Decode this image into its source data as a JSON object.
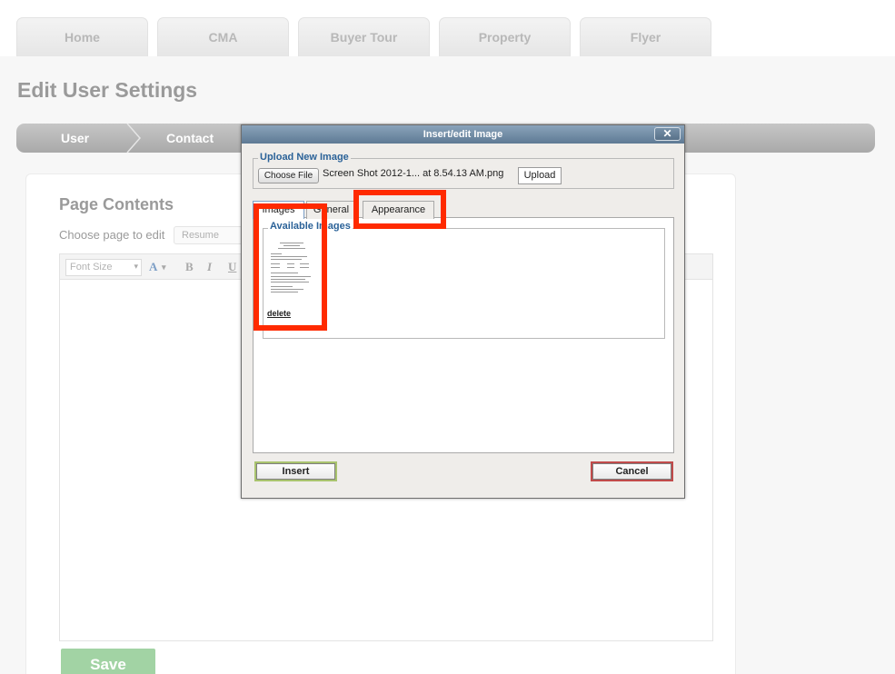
{
  "nav": {
    "tabs": [
      {
        "label": "Home"
      },
      {
        "label": "CMA"
      },
      {
        "label": "Buyer Tour"
      },
      {
        "label": "Property"
      },
      {
        "label": "Flyer"
      }
    ]
  },
  "page": {
    "title": "Edit User Settings",
    "breadcrumb": [
      "User",
      "Contact"
    ]
  },
  "content": {
    "section_title": "Page Contents",
    "choose_label": "Choose page to edit",
    "page_select_value": "Resume",
    "toolbar": {
      "font_size": "Font Size",
      "font_color": "A",
      "bold": "B",
      "italic": "I",
      "underline": "U"
    },
    "save_label": "Save"
  },
  "dialog": {
    "title": "Insert/edit Image",
    "close": "✕",
    "upload_legend": "Upload New Image",
    "choose_file": "Choose File",
    "file_name": "Screen Shot 2012-1... at 8.54.13 AM.png",
    "upload_label": "Upload",
    "tabs": [
      "Images",
      "General",
      "Appearance"
    ],
    "images_legend": "Available Images",
    "delete_label": "delete",
    "insert_label": "Insert",
    "cancel_label": "Cancel"
  },
  "colors": {
    "highlight": "#ff2a00",
    "accent": "#2b6298",
    "save": "#a2d3a4"
  }
}
